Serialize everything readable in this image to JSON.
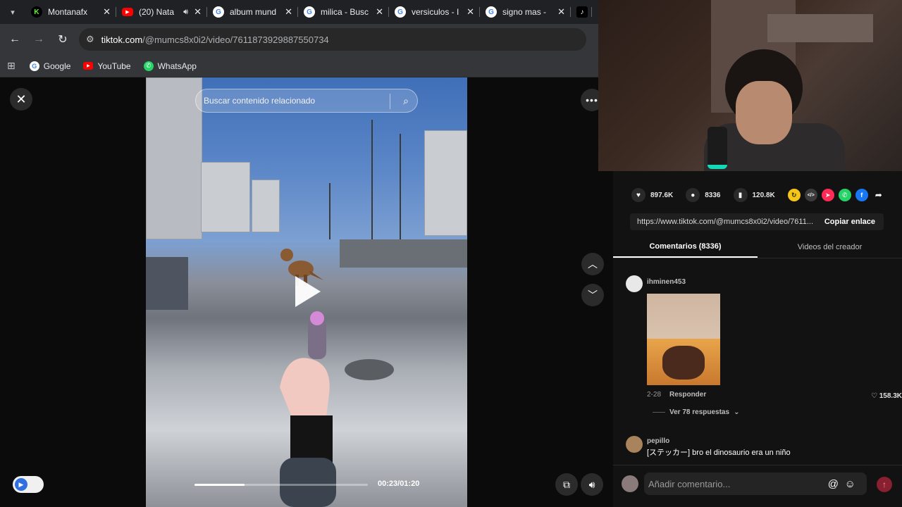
{
  "browser": {
    "tabs": [
      {
        "title": "Montanafx",
        "icon": "kick-icon",
        "color": "#53fc18"
      },
      {
        "title": "(20) Nata",
        "icon": "youtube-icon",
        "color": "#ff0000",
        "audio": true
      },
      {
        "title": "album mund",
        "icon": "google-icon",
        "color": "#4285f4"
      },
      {
        "title": "milica - Busc",
        "icon": "google-icon",
        "color": "#4285f4"
      },
      {
        "title": "versiculos - I",
        "icon": "google-icon",
        "color": "#4285f4"
      },
      {
        "title": "signo mas -",
        "icon": "google-icon",
        "color": "#4285f4"
      }
    ],
    "address": {
      "host": "tiktok.com",
      "path": "/@mumcs8x0i2/video/7611873929887550734"
    },
    "bookmarks": [
      {
        "label": "Google",
        "icon": "google-icon"
      },
      {
        "label": "YouTube",
        "icon": "youtube-icon"
      },
      {
        "label": "WhatsApp",
        "icon": "whatsapp-icon"
      }
    ]
  },
  "video": {
    "search_placeholder": "Buscar contenido relacionado",
    "time": "00:23/01:20",
    "progress": 0.29
  },
  "panel": {
    "actions": {
      "likes": "897.6K",
      "comments": "8336",
      "saves": "120.8K"
    },
    "share_icons": [
      {
        "name": "repost-icon",
        "color": "#f5c518",
        "glyph": "↻"
      },
      {
        "name": "embed-icon",
        "color": "#3a3a3a",
        "glyph": "</>"
      },
      {
        "name": "send-icon",
        "color": "#fe2c55",
        "glyph": "➤"
      },
      {
        "name": "whatsapp-icon",
        "color": "#25d366",
        "glyph": "✆"
      },
      {
        "name": "facebook-icon",
        "color": "#1877f2",
        "glyph": "f"
      }
    ],
    "link": "https://www.tiktok.com/@mumcs8x0i2/video/7611...",
    "copy_label": "Copiar enlace",
    "tabs": [
      "Comentarios (8336)",
      "Videos del creador"
    ],
    "comments": [
      {
        "user": "ihminen453",
        "date": "2-28",
        "reply": "Responder",
        "likes": "158.3K",
        "replies": "Ver 78 respuestas"
      },
      {
        "user": "pepillo",
        "text": "[ステッカー] bro el dinosaurio era un niño"
      }
    ],
    "composer_placeholder": "Añadir comentario..."
  }
}
